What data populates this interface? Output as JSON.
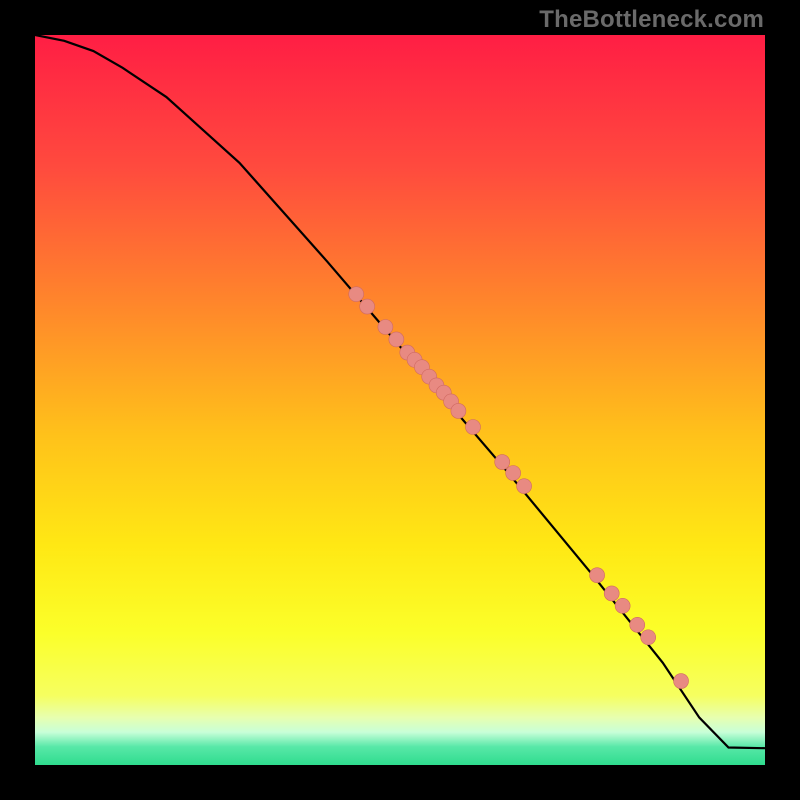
{
  "watermark": "TheBottleneck.com",
  "colors": {
    "frame": "#000000",
    "curve": "#000000",
    "point_fill": "#e88a82",
    "point_stroke": "#d06a62",
    "gradient_stops": [
      {
        "offset": 0.0,
        "color": "#ff1e44"
      },
      {
        "offset": 0.18,
        "color": "#ff4a3e"
      },
      {
        "offset": 0.38,
        "color": "#ff8a2a"
      },
      {
        "offset": 0.55,
        "color": "#ffc21a"
      },
      {
        "offset": 0.7,
        "color": "#ffe814"
      },
      {
        "offset": 0.82,
        "color": "#fbff2a"
      },
      {
        "offset": 0.905,
        "color": "#f6ff60"
      },
      {
        "offset": 0.935,
        "color": "#e7ffb0"
      },
      {
        "offset": 0.955,
        "color": "#c8ffd8"
      },
      {
        "offset": 0.975,
        "color": "#58e8a8"
      },
      {
        "offset": 1.0,
        "color": "#2fdc8e"
      }
    ]
  },
  "chart_data": {
    "type": "line",
    "title": "",
    "xlabel": "",
    "ylabel": "",
    "xlim": [
      0,
      100
    ],
    "ylim": [
      0,
      100
    ],
    "grid": false,
    "legend": false,
    "series": [
      {
        "name": "curve",
        "kind": "line",
        "x": [
          0,
          4,
          8,
          12,
          18,
          28,
          40,
          52,
          64,
          76,
          86,
          91,
          95,
          100
        ],
        "y": [
          100,
          99.2,
          97.8,
          95.5,
          91.5,
          82.5,
          69.0,
          55.0,
          41.0,
          26.5,
          14.0,
          6.5,
          2.4,
          2.3
        ]
      },
      {
        "name": "points",
        "kind": "scatter",
        "x": [
          44.0,
          45.5,
          48.0,
          49.5,
          51.0,
          52.0,
          53.0,
          54.0,
          55.0,
          56.0,
          57.0,
          58.0,
          60.0,
          64.0,
          65.5,
          67.0,
          77.0,
          79.0,
          80.5,
          82.5,
          84.0,
          88.5
        ],
        "y": [
          64.5,
          62.8,
          60.0,
          58.3,
          56.5,
          55.5,
          54.5,
          53.2,
          52.0,
          51.0,
          49.8,
          48.5,
          46.3,
          41.5,
          40.0,
          38.2,
          26.0,
          23.5,
          21.8,
          19.2,
          17.5,
          11.5
        ]
      }
    ]
  }
}
